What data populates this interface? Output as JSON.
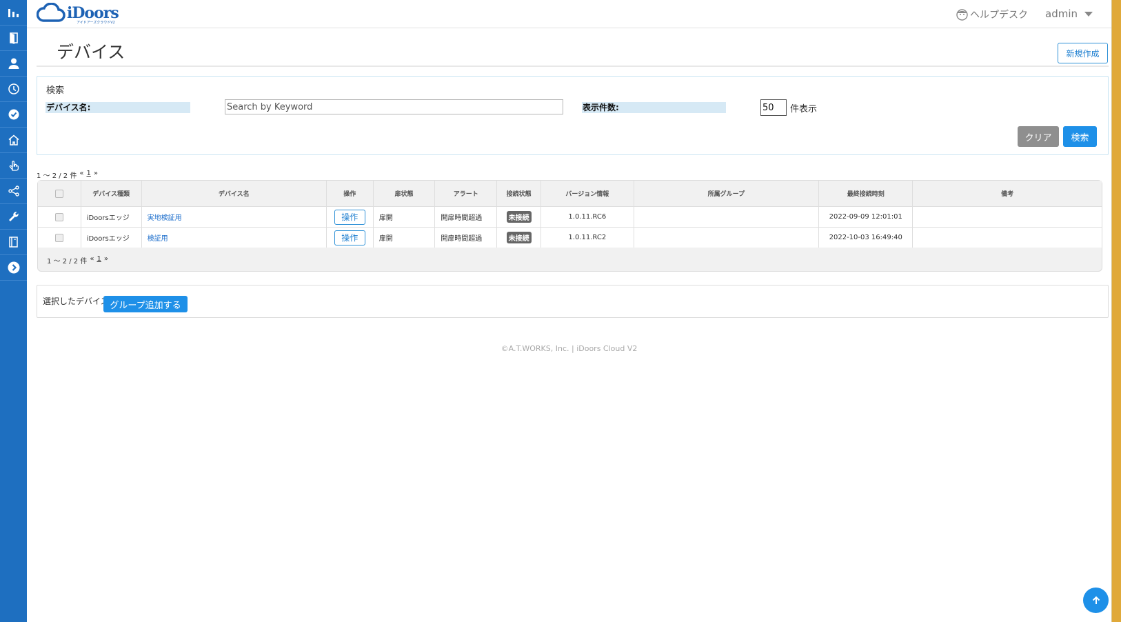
{
  "brand": {
    "name": "iDoors",
    "tagline": "アイドアーズクラウドV2"
  },
  "header": {
    "helpdesk_label": "ヘルプデスク",
    "user_label": "admin"
  },
  "sidebar": {
    "items": [
      {
        "icon": "bar-chart-icon"
      },
      {
        "icon": "door-icon"
      },
      {
        "icon": "user-icon"
      },
      {
        "icon": "clock-icon"
      },
      {
        "icon": "check-circle-icon"
      },
      {
        "icon": "home-icon"
      },
      {
        "icon": "hand-pointer-icon"
      },
      {
        "icon": "share-icon"
      },
      {
        "icon": "wrench-icon"
      },
      {
        "icon": "book-icon"
      },
      {
        "icon": "chevron-right-circle-icon"
      }
    ]
  },
  "page": {
    "title": "デバイス",
    "new_button": "新規作成"
  },
  "search": {
    "heading": "検索",
    "device_name_label": "デバイス名:",
    "keyword_placeholder": "Search by Keyword",
    "count_label": "表示件数:",
    "count_value": "50",
    "count_suffix": "件表示",
    "clear_button": "クリア",
    "search_button": "検索"
  },
  "pager": {
    "summary": "1 〜 2 / 2 件",
    "prev": "«",
    "page": "1",
    "next": "»"
  },
  "table": {
    "headers": [
      "デバイス種類",
      "デバイス名",
      "操作",
      "扉状態",
      "アラート",
      "接続状態",
      "バージョン情報",
      "所属グループ",
      "最終接続時刻",
      "備考"
    ],
    "rows": [
      {
        "type": "iDoorsエッジ",
        "name": "実地検証用",
        "op": "操作",
        "door": "扉開",
        "alert": "開扉時間超過",
        "conn": "未接続",
        "version": "1.0.11.RC6",
        "group": "",
        "last": "2022-09-09 12:01:01",
        "note": ""
      },
      {
        "type": "iDoorsエッジ",
        "name": "検証用",
        "op": "操作",
        "door": "扉開",
        "alert": "開扉時間超過",
        "conn": "未接続",
        "version": "1.0.11.RC2",
        "group": "",
        "last": "2022-10-03 16:49:40",
        "note": ""
      }
    ]
  },
  "bulk": {
    "label": "選択したデバイスへ",
    "group_add_button": "グループ追加する"
  },
  "footer": {
    "text": "©A.T.WORKS, Inc.  |  iDoors Cloud V2"
  },
  "colors": {
    "sidebar": "#1e6fc0",
    "accent": "#1e90e8",
    "outer_frame": "#e0a93a"
  }
}
